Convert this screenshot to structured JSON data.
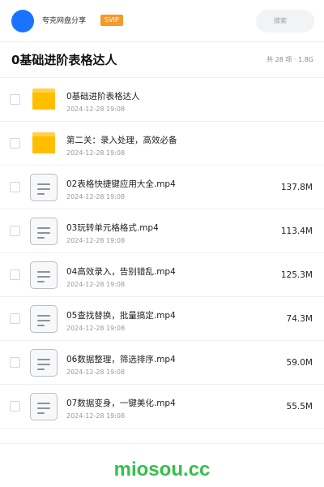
{
  "header": {
    "brand": "夸克网盘分享",
    "badge": "SVIP",
    "search_placeholder": "搜索"
  },
  "folder": {
    "title": "0基础进阶表格达人",
    "meta": "共 28 项 · 1.8G"
  },
  "items": [
    {
      "type": "folder",
      "name": "0基础进阶表格达人",
      "date": "2024-12-28 19:08",
      "size": ""
    },
    {
      "type": "folder",
      "name": "第二关：录入处理，高效必备",
      "date": "2024-12-28 19:08",
      "size": ""
    },
    {
      "type": "video",
      "name": "02表格快捷键应用大全.mp4",
      "date": "2024-12-28 19:08",
      "size": "137.8M"
    },
    {
      "type": "video",
      "name": "03玩转单元格格式.mp4",
      "date": "2024-12-28 19:08",
      "size": "113.4M"
    },
    {
      "type": "video",
      "name": "04高效录入，告别错乱.mp4",
      "date": "2024-12-28 19:08",
      "size": "125.3M"
    },
    {
      "type": "video",
      "name": "05查找替换，批量搞定.mp4",
      "date": "2024-12-28 19:08",
      "size": "74.3M"
    },
    {
      "type": "video",
      "name": "06数据整理，筛选排序.mp4",
      "date": "2024-12-28 19:08",
      "size": "59.0M"
    },
    {
      "type": "video",
      "name": "07数据变身，一键美化.mp4",
      "date": "2024-12-28 19:08",
      "size": "55.5M"
    }
  ],
  "watermark": "miosou.cc",
  "colors": {
    "accent": "#1a73ff",
    "badge": "#f39a2b",
    "folder": "#ffbf00",
    "watermark": "#33c04a"
  }
}
